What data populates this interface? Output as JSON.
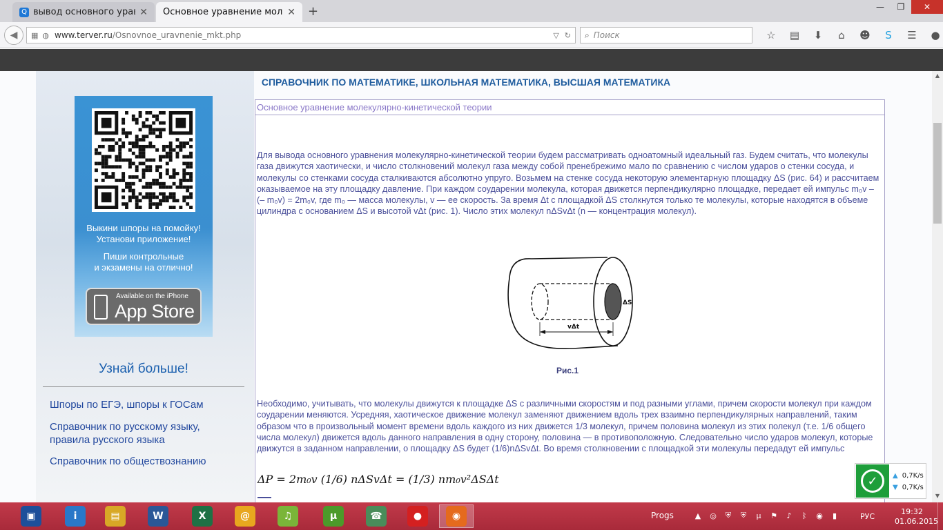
{
  "browser": {
    "tabs": [
      {
        "title": "вывод основного уравне..."
      },
      {
        "title": "Основное уравнение молекул..."
      }
    ],
    "new_tab": "+",
    "window_controls": {
      "minimize": "—",
      "maximize": "❐",
      "close": "✕"
    },
    "url_host": "www.terver.ru",
    "url_path": "/Osnovnoe_uravnenie_mkt.php",
    "search_placeholder": "Поиск"
  },
  "site": {
    "header": "СПРАВОЧНИК ПО МАТЕМАТИКЕ, ШКОЛЬНАЯ МАТЕМАТИКА, ВЫСШАЯ МАТЕМАТИКА"
  },
  "sidebar": {
    "promo_line1": "Выкини шпоры на помойку!",
    "promo_line2": "Установи приложение!",
    "promo_line3": "Пиши контрольные",
    "promo_line4": "и экзамены на отлично!",
    "appstore_small": "Available on the iPhone",
    "appstore_big": "App Store",
    "learn_more": "Узнай больше!",
    "links": [
      {
        "label": "Шпоры по ЕГЭ, шпоры к ГОСам"
      },
      {
        "label": "Справочник по русскому языку, правила русского языка"
      },
      {
        "label": "Справочник по обществознанию"
      }
    ]
  },
  "article": {
    "title": "Основное уравнение молекулярно-кинетической теории",
    "para1": "Для вывода основного уравнения молекулярно-кинетической теории будем рассматривать одноатомный идеальный газ. Будем считать, что молекулы газа движутся хаотически, и число столкновений молекул газа между собой пренебрежимо мало по сравнению с числом ударов о стенки сосуда, и молекулы со стенками сосуда сталкиваются абсолютно упруго. Возьмем на стенке сосуда некоторую элементарную площадку ΔS (рис. 64) и рассчитаем оказываемое на эту площадку давление. При каждом соударении молекула, которая движется перпендикулярно площадке, передает ей импульс m₀v – (– m₀v) = 2m₀v, где m₀ — масса молекулы, v — ее скорость. За время Δt с площадкой ΔS столкнутся только те молекулы, которые находятся в объеме цилиндра с основанием ΔS и высотой vΔt (рис. 1). Число этих молекул nΔSvΔt (n — концентрация молекул).",
    "fig_label_area": "ΔS",
    "fig_label_height": "vΔt",
    "fig_caption": "Рис.1",
    "para2": "Необходимо, учитывать, что молекулы движутся к площадке ΔS с различными скоростям и под разными углами, причем скорости молекул при каждом соударении меняются. Усредняя, хаотическое движение молекул заменяют движением вдоль трех взаимно перпендикулярных направлений, таким образом что в произвольный момент времени вдоль каждого из них движется 1/3 молекул, причем половина молекул из этих полекул (т.е. 1/6 общего числа молекул) движется вдоль данного направления в одну сторону, половина — в противоположную. Следовательно число ударов молекул, которые движутся в заданном направлении, о площадку ΔS будет (1/6)nΔSvΔt. Во время столкновении с площадкой эти молекулы передадут ей импульс",
    "formula": "ΔP = 2m₀v (1/6) nΔSvΔt = (1/3) nm₀v²ΔSΔt"
  },
  "net_widget": {
    "upload": "0,7K/s",
    "download": "0,7K/s"
  },
  "taskbar": {
    "apps": [
      {
        "name": "save-app",
        "glyph": "▣",
        "color": "#1d4f9a"
      },
      {
        "name": "help-app",
        "glyph": "i",
        "color": "#2a78c8"
      },
      {
        "name": "explorer-app",
        "glyph": "▤",
        "color": "#d8a826"
      },
      {
        "name": "word-app",
        "glyph": "W",
        "color": "#2b5797"
      },
      {
        "name": "excel-app",
        "glyph": "X",
        "color": "#1e7145"
      },
      {
        "name": "mail-app",
        "glyph": "@",
        "color": "#e8a71e"
      },
      {
        "name": "music-app",
        "glyph": "♫",
        "color": "#7ab539"
      },
      {
        "name": "utorrent-app",
        "glyph": "µ",
        "color": "#4c9a2a"
      },
      {
        "name": "phone-app",
        "glyph": "☎",
        "color": "#4a8c5a"
      },
      {
        "name": "record-app",
        "glyph": "●",
        "color": "#d42020"
      },
      {
        "name": "firefox-app",
        "glyph": "◉",
        "color": "#e56a1d"
      }
    ],
    "progs_label": "Progs",
    "language": "РУС",
    "time": "19:32",
    "date": "01.06.2015"
  }
}
